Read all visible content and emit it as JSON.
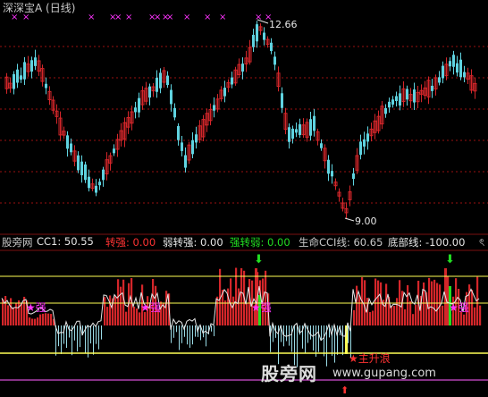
{
  "colors": {
    "bg": "#000000",
    "up": "#d4262a",
    "down": "#5fd3e0",
    "grid": "#9a1111",
    "magenta": "#ff33ff",
    "white": "#e6e6e6",
    "yellow": "#ffff55",
    "green": "#22dd22",
    "orange_level": "#d9a800",
    "purple_level": "#b040b0",
    "red_text": "#ff3333",
    "olive_text": "#c8c800",
    "gray_text": "#c8c8c8"
  },
  "main_pane": {
    "title": "深深宝A (日线)",
    "high_label": "12.66",
    "low_label": "9.00",
    "marker_glyph": "×",
    "marker_count": 15
  },
  "indicator_header": {
    "name": "股旁网",
    "cc1_label": "CC1: 50.55",
    "zhuanqiang_label": "转强: 0.00",
    "ruozhuanqiang_label": "弱转强: 0.00",
    "qiangzhuanruo_label": "强转弱: 0.00",
    "shengming_label": "生命CCI线: 60.65",
    "dibu_label": "底部线: -100.00",
    "scroll_mark": "ৎ"
  },
  "annotations": {
    "star_label_1": "强",
    "star_label_2": "强",
    "star_label_3": "强",
    "star_label_4": "强",
    "bottom_label": "主升浪",
    "star_glyph": "★",
    "arrow_down_glyph": "⬇",
    "arrow_up_glyph": "⬆"
  },
  "watermark": {
    "main": "股旁网",
    "url": "www.gupang.com"
  }
}
